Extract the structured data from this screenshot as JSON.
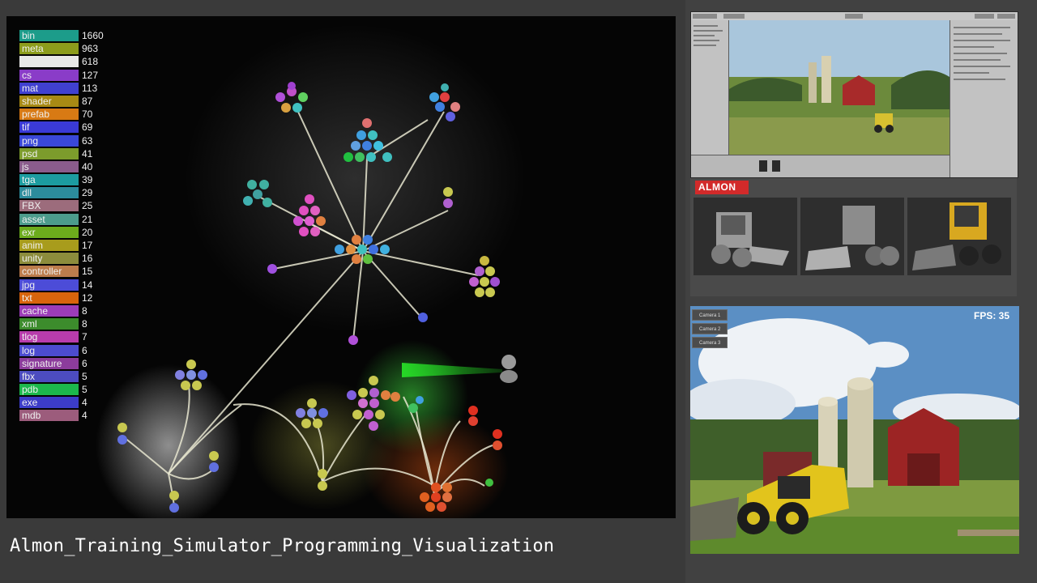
{
  "legend": [
    {
      "ext": "bin",
      "count": "1660",
      "color": "#1c9c8a"
    },
    {
      "ext": "meta",
      "count": "963",
      "color": "#8c9c1c"
    },
    {
      "ext": "",
      "count": "618",
      "color": "#e8e8e8"
    },
    {
      "ext": "cs",
      "count": "127",
      "color": "#8a3cc8"
    },
    {
      "ext": "mat",
      "count": "113",
      "color": "#4040d0"
    },
    {
      "ext": "shader",
      "count": "87",
      "color": "#a88a14"
    },
    {
      "ext": "prefab",
      "count": "70",
      "color": "#d87a14"
    },
    {
      "ext": "tif",
      "count": "69",
      "color": "#3a3ad6"
    },
    {
      "ext": "png",
      "count": "63",
      "color": "#3a48d8"
    },
    {
      "ext": "psd",
      "count": "41",
      "color": "#7c9c2c"
    },
    {
      "ext": "js",
      "count": "40",
      "color": "#8a5c8c"
    },
    {
      "ext": "tga",
      "count": "39",
      "color": "#1c9ca0"
    },
    {
      "ext": "dll",
      "count": "29",
      "color": "#2c8c9c"
    },
    {
      "ext": "FBX",
      "count": "25",
      "color": "#9c6c7c"
    },
    {
      "ext": "asset",
      "count": "21",
      "color": "#4c9c8c"
    },
    {
      "ext": "exr",
      "count": "20",
      "color": "#6cac1c"
    },
    {
      "ext": "anim",
      "count": "17",
      "color": "#a89c1c"
    },
    {
      "ext": "unity",
      "count": "16",
      "color": "#8c8c3c"
    },
    {
      "ext": "controller",
      "count": "15",
      "color": "#bc7c4c"
    },
    {
      "ext": "jpg",
      "count": "14",
      "color": "#4c4cd8"
    },
    {
      "ext": "txt",
      "count": "12",
      "color": "#d8640c"
    },
    {
      "ext": "cache",
      "count": "8",
      "color": "#9c3cb8"
    },
    {
      "ext": "xml",
      "count": "8",
      "color": "#3c8c2c"
    },
    {
      "ext": "tlog",
      "count": "7",
      "color": "#b83cac"
    },
    {
      "ext": "log",
      "count": "6",
      "color": "#4c4cd0"
    },
    {
      "ext": "signature",
      "count": "6",
      "color": "#8c3c9c"
    },
    {
      "ext": "fbx",
      "count": "5",
      "color": "#4c4cc0"
    },
    {
      "ext": "pdb",
      "count": "5",
      "color": "#1cb84c"
    },
    {
      "ext": "exe",
      "count": "4",
      "color": "#3c3cc8"
    },
    {
      "ext": "mdb",
      "count": "4",
      "color": "#9c5c7c"
    }
  ],
  "caption": "Almon_Training_Simulator_Programming_Visualization",
  "logo": "ALMON",
  "camera_buttons": [
    "Camera 1",
    "Camera 2",
    "Camera 3"
  ],
  "fps": "FPS: 35"
}
